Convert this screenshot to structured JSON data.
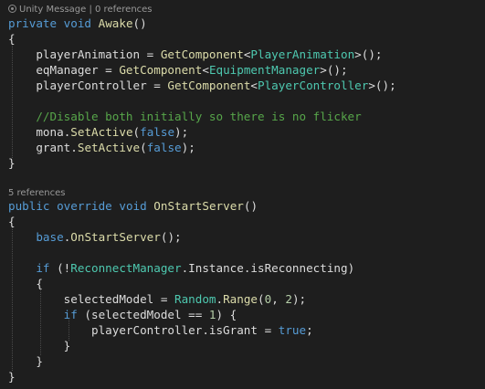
{
  "colors": {
    "background": "#1e1e1e",
    "keyword": "#569cd6",
    "type": "#4ec9b0",
    "method": "#dcdcaa",
    "number": "#b5cea8",
    "comment": "#57a64a",
    "plain": "#dcdcdc",
    "codelens": "#999999"
  },
  "codelens": {
    "awake": {
      "label": "Unity Message",
      "separator": " | ",
      "refs": "0 references",
      "icon": "unity-icon"
    },
    "onstartserver": {
      "refs": "5 references"
    }
  },
  "code": {
    "l1": {
      "kw1": "private",
      "kw2": "void",
      "method": "Awake",
      "punc": "()"
    },
    "brace_open": "{",
    "brace_close": "}",
    "l3": {
      "field": "playerAnimation",
      "eq": " = ",
      "call": "GetComponent",
      "lt": "<",
      "type": "PlayerAnimation",
      "end": ">();"
    },
    "l4": {
      "field": "eqManager",
      "eq": " = ",
      "call": "GetComponent",
      "lt": "<",
      "type": "EquipmentManager",
      "end": ">();"
    },
    "l5": {
      "field": "playerController",
      "eq": " = ",
      "call": "GetComponent",
      "lt": "<",
      "type": "PlayerController",
      "end": ">();"
    },
    "l7": {
      "comment": "//Disable both initially so there is no flicker"
    },
    "l8": {
      "obj": "mona",
      "dot": ".",
      "call": "SetActive",
      "open": "(",
      "val": "false",
      "close": ");"
    },
    "l9": {
      "obj": "grant",
      "dot": ".",
      "call": "SetActive",
      "open": "(",
      "val": "false",
      "close": ");"
    },
    "l12": {
      "kw1": "public",
      "kw2": "override",
      "kw3": "void",
      "method": "OnStartServer",
      "punc": "()"
    },
    "l14": {
      "kw": "base",
      "dot": ".",
      "call": "OnStartServer",
      "end": "();"
    },
    "l16": {
      "kw": "if",
      "open": " (!",
      "type": "ReconnectManager",
      "rest": ".Instance.isReconnecting)"
    },
    "l18": {
      "field": "selectedModel",
      "eq": " = ",
      "type": "Random",
      "dot": ".",
      "call": "Range",
      "open": "(",
      "n1": "0",
      "comma": ", ",
      "n2": "2",
      "close": ");"
    },
    "l19": {
      "kw": "if",
      "cond": " (selectedModel == ",
      "num": "1",
      "end": ") {"
    },
    "l20": {
      "field": "playerController.isGrant",
      "eq": " = ",
      "val": "true",
      "end": ";"
    }
  }
}
